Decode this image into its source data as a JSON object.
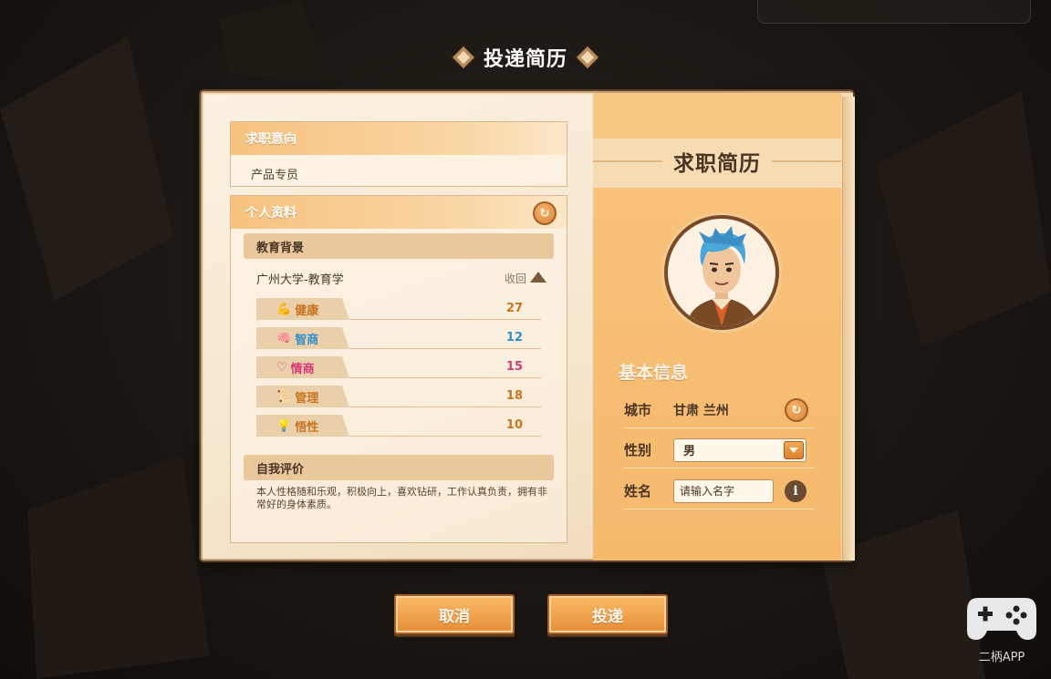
{
  "title": "投递简历",
  "left": {
    "intent": {
      "heading": "求职意向",
      "value": "产品专员"
    },
    "profile": {
      "heading": "个人资料",
      "education": {
        "heading": "教育背景",
        "school": "广州大学-教育学",
        "collapse_label": "收回"
      },
      "stats": [
        {
          "label": "健康",
          "icon": "muscle-icon",
          "value": "27",
          "color": "#c9741f"
        },
        {
          "label": "智商",
          "icon": "brain-icon",
          "value": "12",
          "color": "#2f8fcc"
        },
        {
          "label": "情商",
          "icon": "heart-icon",
          "value": "15",
          "color": "#d9397a"
        },
        {
          "label": "管理",
          "icon": "scroll-icon",
          "value": "18",
          "color": "#c9741f"
        },
        {
          "label": "悟性",
          "icon": "lightbulb-icon",
          "value": "10",
          "color": "#c9741f"
        }
      ],
      "self_eval": {
        "heading": "自我评价",
        "text": "本人性格随和乐观，积极向上，喜欢钻研，工作认真负责，拥有非常好的身体素质。"
      }
    }
  },
  "right": {
    "title": "求职简历",
    "basic_info_title": "基本信息",
    "city": {
      "label": "城市",
      "value": "甘肃 兰州"
    },
    "gender": {
      "label": "性别",
      "value": "男"
    },
    "name": {
      "label": "姓名",
      "placeholder": "请输入名字"
    }
  },
  "buttons": {
    "cancel": "取消",
    "submit": "投递"
  },
  "watermark": "二柄APP"
}
